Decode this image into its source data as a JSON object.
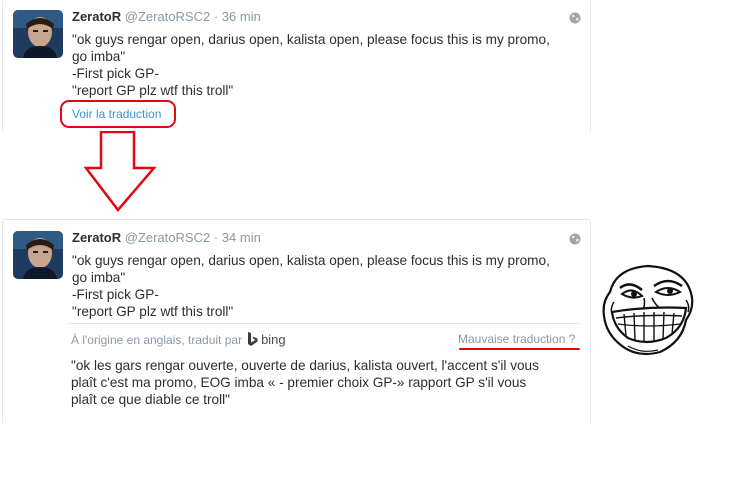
{
  "tweet_original": {
    "name": "ZeratoR",
    "handle": "@ZeratoRSC2",
    "separator": "·",
    "time": "36 min",
    "lines": [
      "\"ok guys rengar open, darius open, kalista open, please focus this is my promo,",
      "go imba\"",
      "-First pick GP-",
      "\"report GP plz wtf this troll\""
    ],
    "translate_link": "Voir la traduction"
  },
  "tweet_translated": {
    "name": "ZeratoR",
    "handle": "@ZeratoRSC2",
    "separator": "·",
    "time": "34 min",
    "lines": [
      "\"ok guys rengar open, darius open, kalista open, please focus this is my promo,",
      "go imba\"",
      "-First pick GP-",
      "\"report GP plz wtf this troll\""
    ],
    "translated_by": "À l'origine en anglais, traduit par",
    "translator_brand": "bing",
    "bad_translation_link": "Mauvaise traduction ?",
    "translation_lines": [
      "\"ok les gars rengar ouverte, ouverte de darius, kalista ouvert, l'accent s'il vous",
      "plaît c'est ma promo, EOG imba « - premier choix GP-» rapport GP s'il vous",
      "plaît ce que diable ce troll\""
    ]
  },
  "colors": {
    "annotation_red": "#e30613",
    "link_blue": "#3b94d9",
    "muted_gray": "#8899a6",
    "text_dark": "#292f33"
  },
  "icons": [
    "globe-icon",
    "bing-logo-icon",
    "down-arrow-annotation",
    "trollface-meme"
  ]
}
